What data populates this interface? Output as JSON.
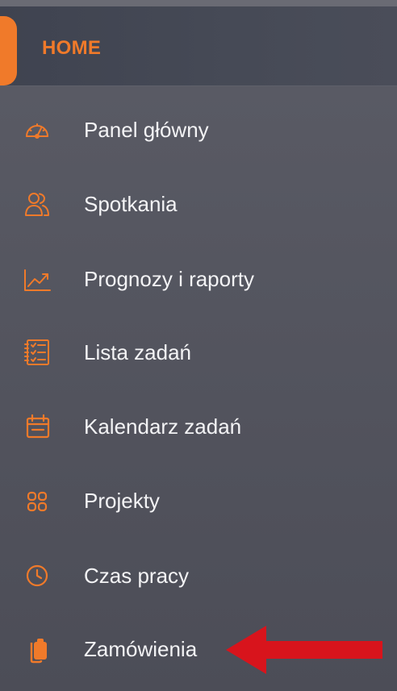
{
  "section": {
    "title": "HOME"
  },
  "menu": {
    "items": [
      {
        "label": "Panel główny",
        "icon": "speedometer-icon"
      },
      {
        "label": "Spotkania",
        "icon": "users-icon"
      },
      {
        "label": "Prognozy i raporty",
        "icon": "chart-line-icon"
      },
      {
        "label": "Lista zadań",
        "icon": "checklist-icon"
      },
      {
        "label": "Kalendarz zadań",
        "icon": "calendar-icon"
      },
      {
        "label": "Projekty",
        "icon": "grid-icon"
      },
      {
        "label": "Czas pracy",
        "icon": "clock-icon"
      },
      {
        "label": "Zamówienia",
        "icon": "clipboard-icon"
      }
    ]
  },
  "colors": {
    "accent": "#f07a2a",
    "annotation_arrow": "#d8141c",
    "text": "#f3f3f5"
  }
}
